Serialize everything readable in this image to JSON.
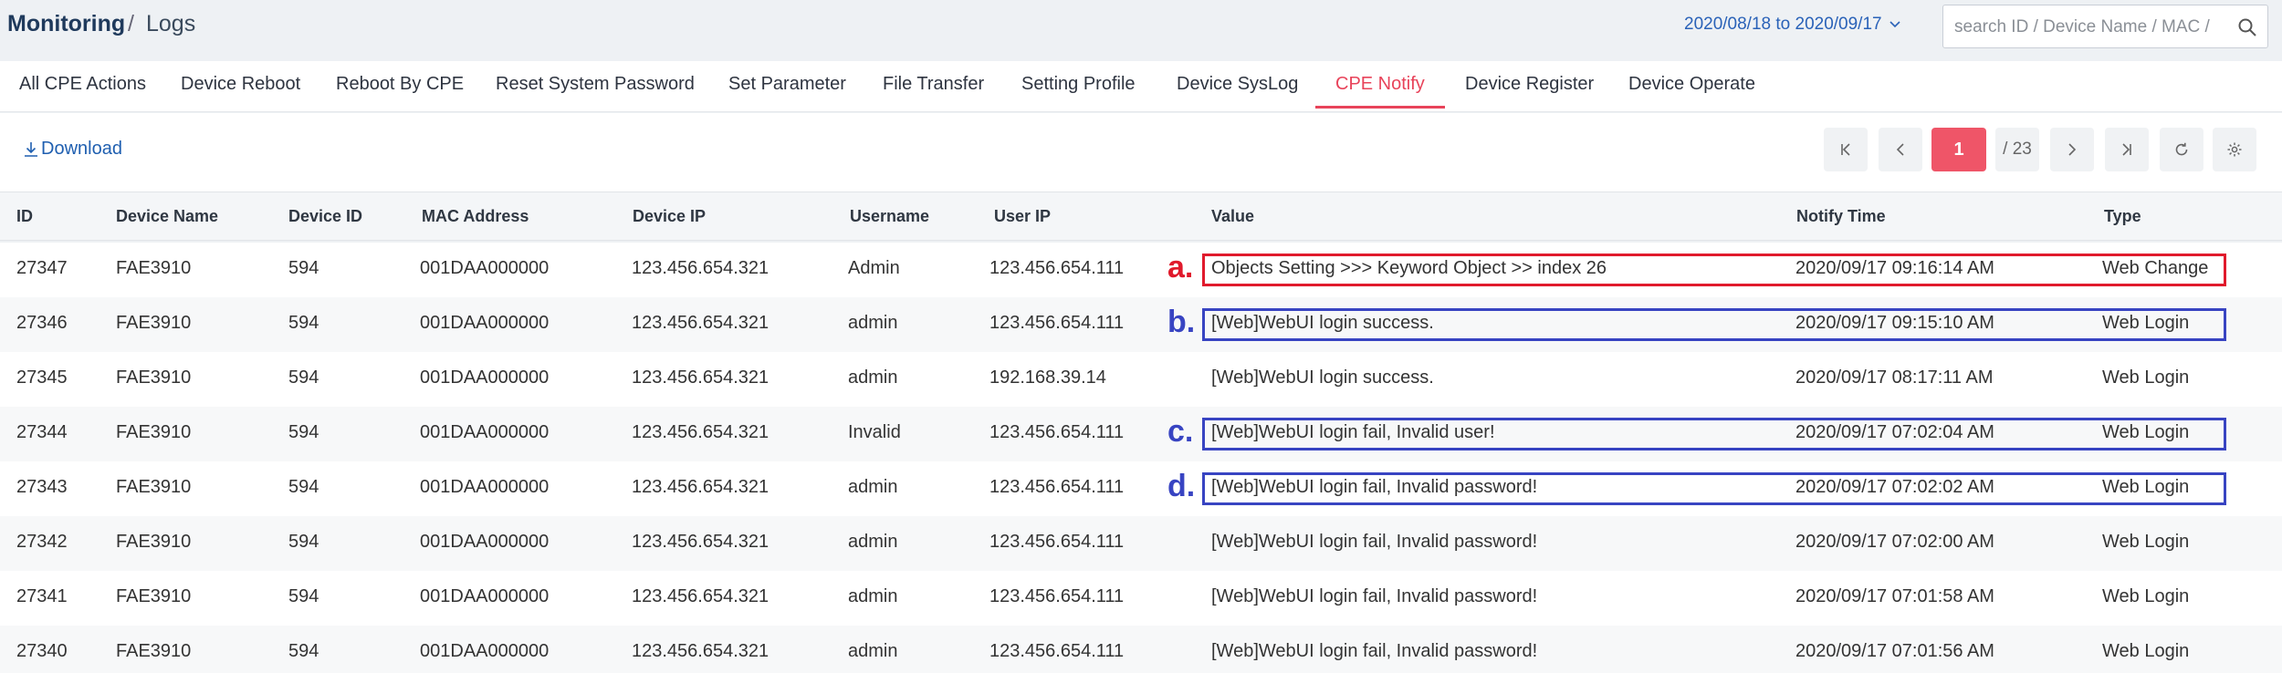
{
  "breadcrumb": {
    "root": "Monitoring",
    "separator": "/",
    "current": "Logs"
  },
  "date_range": "2020/08/18 to 2020/09/17",
  "search": {
    "placeholder": "search ID / Device Name / MAC /"
  },
  "tabs": [
    {
      "label": "All CPE Actions",
      "active": false
    },
    {
      "label": "Device Reboot",
      "active": false
    },
    {
      "label": "Reboot By CPE",
      "active": false
    },
    {
      "label": "Reset System Password",
      "active": false
    },
    {
      "label": "Set Parameter",
      "active": false
    },
    {
      "label": "File Transfer",
      "active": false
    },
    {
      "label": "Setting Profile",
      "active": false
    },
    {
      "label": "Device SysLog",
      "active": false
    },
    {
      "label": "CPE Notify",
      "active": true
    },
    {
      "label": "Device Register",
      "active": false
    },
    {
      "label": "Device Operate",
      "active": false
    }
  ],
  "toolbar": {
    "download_label": "Download"
  },
  "pagination": {
    "current_page": "1",
    "total": "/ 23"
  },
  "colors": {
    "accent": "#ef5568",
    "link": "#1f5fb0",
    "highlight_blue": "#3844c2",
    "highlight_red": "#e01a2c"
  },
  "table": {
    "headers": {
      "id": "ID",
      "device_name": "Device Name",
      "device_id": "Device ID",
      "mac": "MAC Address",
      "device_ip": "Device IP",
      "username": "Username",
      "user_ip": "User IP",
      "value": "Value",
      "notify_time": "Notify Time",
      "type": "Type"
    },
    "rows": [
      {
        "id": "27347",
        "device_name": "FAE3910",
        "device_id": "594",
        "mac": "001DAA000000",
        "device_ip": "123.456.654.321",
        "username": "Admin",
        "user_ip": "123.456.654.111",
        "value": "Objects Setting >>> Keyword Object >> index 26",
        "notify_time": "2020/09/17 09:16:14 AM",
        "type": "Web Change",
        "marker": "a.",
        "highlight": "red"
      },
      {
        "id": "27346",
        "device_name": "FAE3910",
        "device_id": "594",
        "mac": "001DAA000000",
        "device_ip": "123.456.654.321",
        "username": "admin",
        "user_ip": "123.456.654.111",
        "value": "[Web]WebUI login success.",
        "notify_time": "2020/09/17 09:15:10 AM",
        "type": "Web Login",
        "marker": "b.",
        "highlight": "blue"
      },
      {
        "id": "27345",
        "device_name": "FAE3910",
        "device_id": "594",
        "mac": "001DAA000000",
        "device_ip": "123.456.654.321",
        "username": "admin",
        "user_ip": "192.168.39.14",
        "value": "[Web]WebUI login success.",
        "notify_time": "2020/09/17 08:17:11 AM",
        "type": "Web Login",
        "marker": "",
        "highlight": ""
      },
      {
        "id": "27344",
        "device_name": "FAE3910",
        "device_id": "594",
        "mac": "001DAA000000",
        "device_ip": "123.456.654.321",
        "username": "Invalid",
        "user_ip": "123.456.654.111",
        "value": "[Web]WebUI login fail, Invalid user!",
        "notify_time": "2020/09/17 07:02:04 AM",
        "type": "Web Login",
        "marker": "c.",
        "highlight": "blue"
      },
      {
        "id": "27343",
        "device_name": "FAE3910",
        "device_id": "594",
        "mac": "001DAA000000",
        "device_ip": "123.456.654.321",
        "username": "admin",
        "user_ip": "123.456.654.111",
        "value": "[Web]WebUI login fail, Invalid password!",
        "notify_time": "2020/09/17 07:02:02 AM",
        "type": "Web Login",
        "marker": "d.",
        "highlight": "blue"
      },
      {
        "id": "27342",
        "device_name": "FAE3910",
        "device_id": "594",
        "mac": "001DAA000000",
        "device_ip": "123.456.654.321",
        "username": "admin",
        "user_ip": "123.456.654.111",
        "value": "[Web]WebUI login fail, Invalid password!",
        "notify_time": "2020/09/17 07:02:00 AM",
        "type": "Web Login",
        "marker": "",
        "highlight": ""
      },
      {
        "id": "27341",
        "device_name": "FAE3910",
        "device_id": "594",
        "mac": "001DAA000000",
        "device_ip": "123.456.654.321",
        "username": "admin",
        "user_ip": "123.456.654.111",
        "value": "[Web]WebUI login fail, Invalid password!",
        "notify_time": "2020/09/17 07:01:58 AM",
        "type": "Web Login",
        "marker": "",
        "highlight": ""
      },
      {
        "id": "27340",
        "device_name": "FAE3910",
        "device_id": "594",
        "mac": "001DAA000000",
        "device_ip": "123.456.654.321",
        "username": "admin",
        "user_ip": "123.456.654.111",
        "value": "[Web]WebUI login fail, Invalid password!",
        "notify_time": "2020/09/17 07:01:56 AM",
        "type": "Web Login",
        "marker": "",
        "highlight": ""
      }
    ]
  }
}
